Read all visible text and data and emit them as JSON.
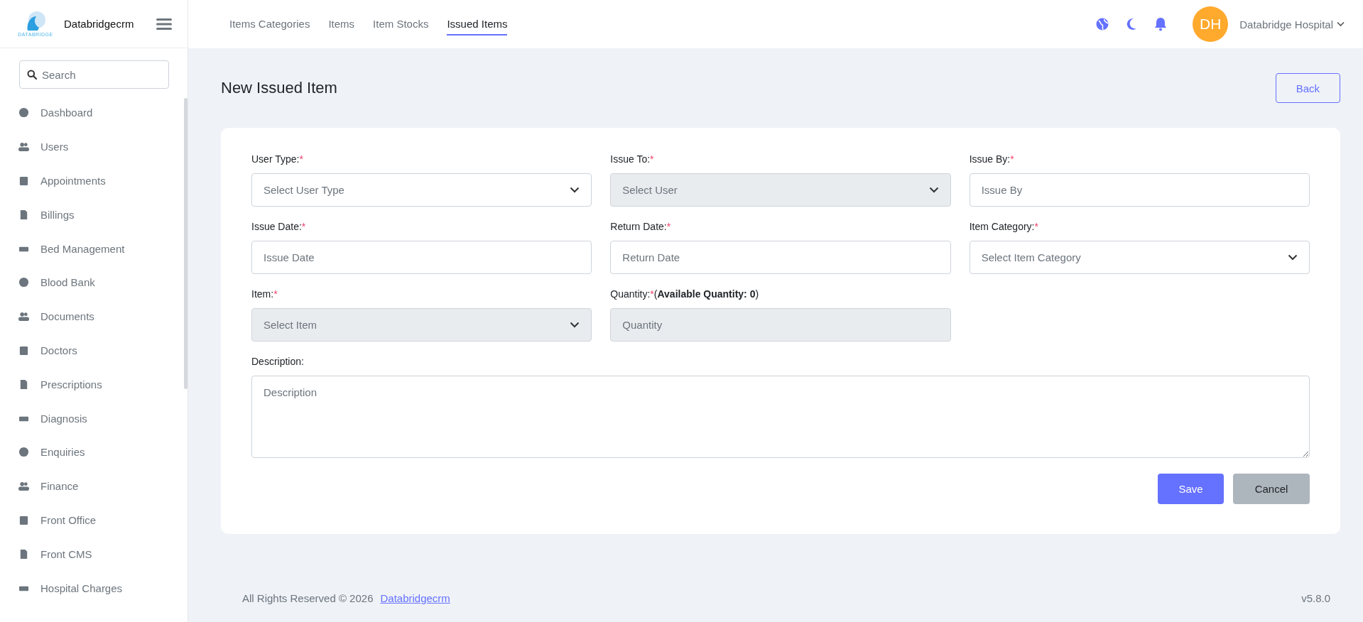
{
  "brand": {
    "name": "Databridgecrm",
    "logo_text": "DATABRIDGE"
  },
  "sidebar": {
    "search": {
      "placeholder": "Search"
    },
    "items": [
      {
        "label": "Dashboard"
      },
      {
        "label": "Users"
      },
      {
        "label": "Appointments"
      },
      {
        "label": "Billings"
      },
      {
        "label": "Bed Management"
      },
      {
        "label": "Blood Bank"
      },
      {
        "label": "Documents"
      },
      {
        "label": "Doctors"
      },
      {
        "label": "Prescriptions"
      },
      {
        "label": "Diagnosis"
      },
      {
        "label": "Enquiries"
      },
      {
        "label": "Finance"
      },
      {
        "label": "Front Office"
      },
      {
        "label": "Front CMS"
      },
      {
        "label": "Hospital Charges"
      }
    ]
  },
  "tabs": [
    {
      "label": "Items Categories",
      "selected": false
    },
    {
      "label": "Items",
      "selected": false
    },
    {
      "label": "Item Stocks",
      "selected": false
    },
    {
      "label": "Issued Items",
      "selected": true
    }
  ],
  "user": {
    "initials": "DH",
    "name": "Databridge Hospital"
  },
  "page": {
    "title": "New Issued Item",
    "back_button": "Back"
  },
  "fields": [
    {
      "kind": "select",
      "label": "User Type:",
      "required": true,
      "placeholder": "Select User Type",
      "disabled": false
    },
    {
      "kind": "select",
      "label": "Issue To:",
      "required": true,
      "placeholder": "Select User",
      "disabled": true
    },
    {
      "kind": "input",
      "label": "Issue By:",
      "required": true,
      "placeholder": "Issue By",
      "disabled": false
    },
    {
      "kind": "input",
      "label": "Issue Date:",
      "required": true,
      "placeholder": "Issue Date",
      "disabled": false
    },
    {
      "kind": "input",
      "label": "Return Date:",
      "required": true,
      "placeholder": "Return Date",
      "disabled": false
    },
    {
      "kind": "select",
      "label": "Item Category:",
      "required": true,
      "placeholder": "Select Item Category",
      "disabled": false
    },
    {
      "kind": "select",
      "label": "Item:",
      "required": true,
      "placeholder": "Select Item",
      "disabled": true
    },
    {
      "kind": "input",
      "label": "Quantity:",
      "required": true,
      "note": "(**Available Quantity: 0**)",
      "placeholder": "Quantity",
      "disabled": true
    },
    {
      "kind": "textarea",
      "label": "Description:",
      "required": false,
      "placeholder": "Description",
      "disabled": false
    }
  ],
  "required_mark": "*",
  "actions": {
    "save": "Save",
    "cancel": "Cancel"
  },
  "footer": {
    "copyright": "All Rights Reserved © 2026",
    "link": "Databridgecrm",
    "version": "v5.8.0"
  }
}
